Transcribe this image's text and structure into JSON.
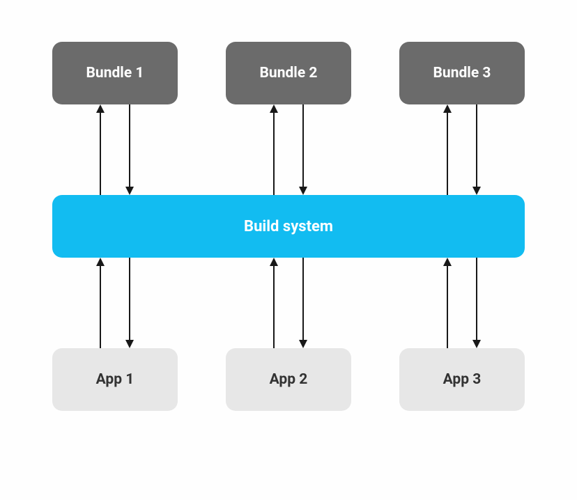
{
  "bundles": [
    {
      "label": "Bundle 1"
    },
    {
      "label": "Bundle 2"
    },
    {
      "label": "Bundle 3"
    }
  ],
  "center": {
    "label": "Build system"
  },
  "apps": [
    {
      "label": "App 1"
    },
    {
      "label": "App 2"
    },
    {
      "label": "App 3"
    }
  ],
  "colors": {
    "bundle_bg": "#6b6b6b",
    "app_bg": "#e7e7e7",
    "center_bg": "#12bcf1",
    "arrow": "#181818"
  }
}
